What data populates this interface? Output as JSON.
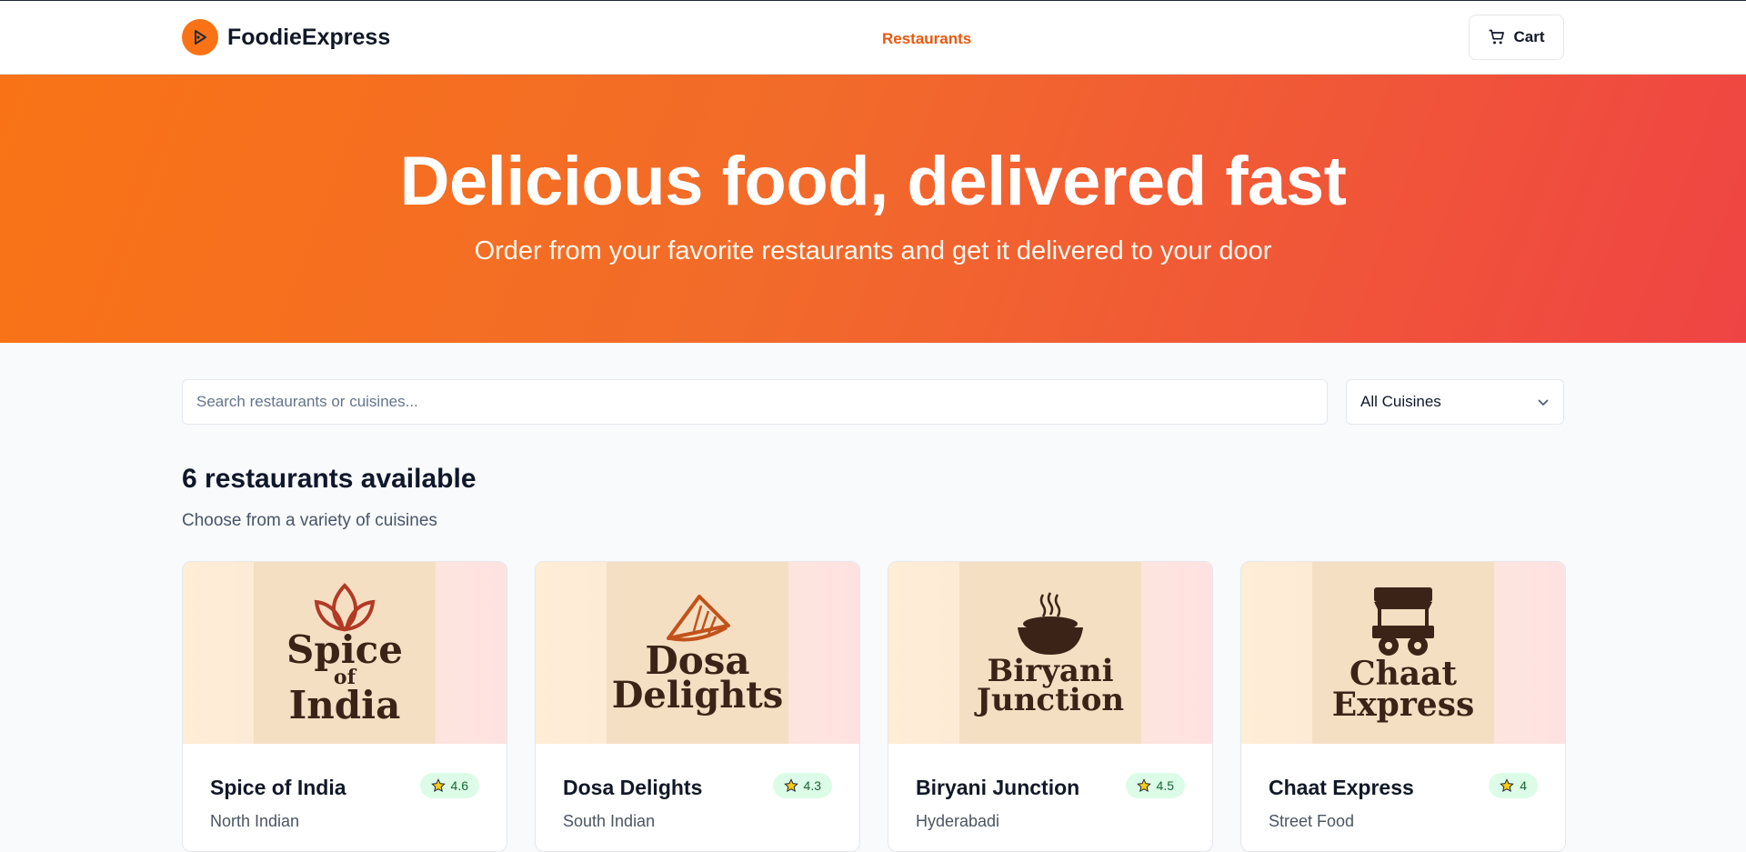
{
  "header": {
    "brand": "FoodieExpress",
    "nav_restaurants": "Restaurants",
    "cart_label": "Cart"
  },
  "hero": {
    "title": "Delicious food, delivered fast",
    "subtitle": "Order from your favorite restaurants and get it delivered to your door"
  },
  "filters": {
    "search_placeholder": "Search restaurants or cuisines...",
    "cuisine_selected": "All Cuisines"
  },
  "listing": {
    "count_heading": "6 restaurants available",
    "subheading": "Choose from a variety of cuisines"
  },
  "restaurants": [
    {
      "name": "Spice of India",
      "cuisine": "North Indian",
      "rating": "4.6",
      "logo_line1": "Spice",
      "logo_line2": "of",
      "logo_line3": "India",
      "icon": "leaf-icon"
    },
    {
      "name": "Dosa Delights",
      "cuisine": "South Indian",
      "rating": "4.3",
      "logo_line1": "Dosa",
      "logo_line2": "Delights",
      "icon": "dosa-icon"
    },
    {
      "name": "Biryani Junction",
      "cuisine": "Hyderabadi",
      "rating": "4.5",
      "logo_line1": "Biryani",
      "logo_line2": "Junction",
      "icon": "bowl-icon"
    },
    {
      "name": "Chaat Express",
      "cuisine": "Street Food",
      "rating": "4",
      "logo_line1": "Chaat",
      "logo_line2": "Express",
      "icon": "food-cart-icon"
    }
  ],
  "colors": {
    "accent": "#f97316",
    "hero_start": "#f97316",
    "hero_end": "#ef4444",
    "rating_bg": "#dcfce7",
    "star": "#facc15"
  }
}
